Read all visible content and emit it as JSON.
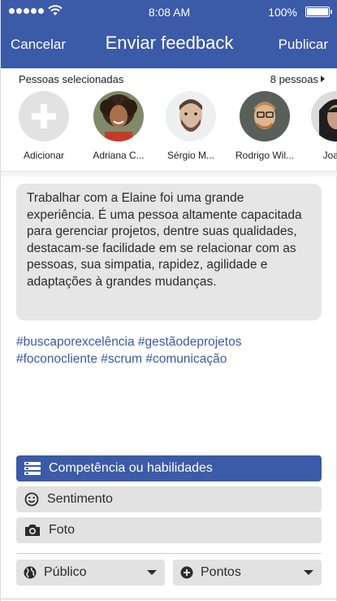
{
  "status_bar": {
    "time": "8:08 AM",
    "battery": "100%"
  },
  "nav": {
    "cancel": "Cancelar",
    "title": "Enviar feedback",
    "publish": "Publicar"
  },
  "people": {
    "header": "Pessoas selecionadas",
    "count": "8 pessoas",
    "items": [
      {
        "name": "Adicionar",
        "icon": "add-icon"
      },
      {
        "name": "Adriana C..."
      },
      {
        "name": "Sérgio M..."
      },
      {
        "name": "Rodrigo Wil..."
      },
      {
        "name": "Joana"
      }
    ]
  },
  "message": "Trabalhar com a Elaine foi uma grande experiência. É uma pessoa altamente capacitada para gerenciar projetos, dentre suas qualidades, destacam-se facilidade em se relacionar com as pessoas, sua simpatia, rapidez, agilidade e adaptações à grandes mudanças.",
  "hashtags": "#buscaporexcelência #gestãodeprojetos #foconocliente #scrum #comunicação",
  "options": [
    {
      "label": "Competência ou habilidades",
      "icon": "list-icon",
      "active": true
    },
    {
      "label": "Sentimento",
      "icon": "smiley-icon",
      "active": false
    },
    {
      "label": "Foto",
      "icon": "camera-icon",
      "active": false
    }
  ],
  "selects": {
    "visibility": {
      "label": "Público",
      "icon": "globe-icon"
    },
    "points": {
      "label": "Pontos",
      "icon": "plus-circle-icon"
    }
  },
  "colors": {
    "brand": "#3b5aa8",
    "panel": "#e2e2e2"
  }
}
